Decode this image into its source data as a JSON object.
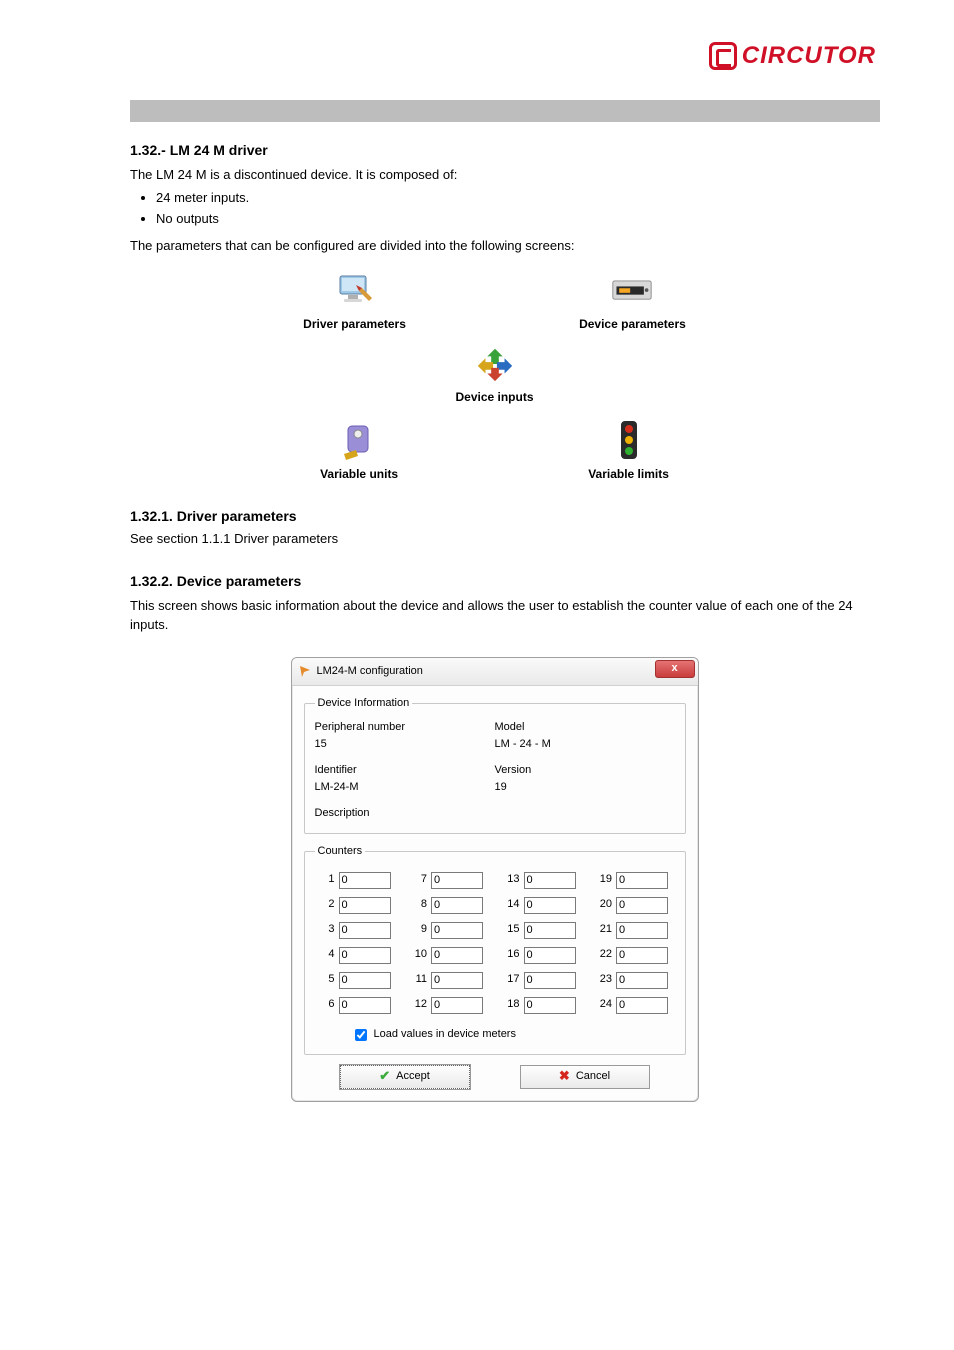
{
  "brand": "CIRCUTOR",
  "section": {
    "number_title": "1.32.- LM 24 M driver",
    "intro": "The LM 24 M is a discontinued device. It is composed of:",
    "bullets": [
      "24 meter inputs.",
      "No outputs"
    ],
    "config_line": "The parameters that can be configured are divided into the following screens:"
  },
  "nav": {
    "driver_parameters": "Driver parameters",
    "device_parameters": "Device parameters",
    "device_inputs": "Device inputs",
    "variable_units": "Variable units",
    "variable_limits": "Variable limits"
  },
  "subsections": {
    "driver_head": "1.32.1.  Driver parameters",
    "driver_text": "See section 1.1.1  Driver parameters",
    "device_head": "1.32.2.  Device parameters",
    "device_text": "This screen shows basic information about the device and allows the user to establish the counter value of each one of the 24 inputs."
  },
  "dialog": {
    "title": "LM24-M configuration",
    "close_glyph": "x",
    "device_info_legend": "Device Information",
    "peripheral_label": "Peripheral number",
    "peripheral_value": "15",
    "model_label": "Model",
    "model_value": "LM - 24 - M",
    "identifier_label": "Identifier",
    "identifier_value": "LM-24-M",
    "version_label": "Version",
    "version_value": "19",
    "description_label": "Description",
    "description_value": "",
    "counters_legend": "Counters",
    "counters": [
      {
        "n": "1",
        "v": "0"
      },
      {
        "n": "2",
        "v": "0"
      },
      {
        "n": "3",
        "v": "0"
      },
      {
        "n": "4",
        "v": "0"
      },
      {
        "n": "5",
        "v": "0"
      },
      {
        "n": "6",
        "v": "0"
      },
      {
        "n": "7",
        "v": "0"
      },
      {
        "n": "8",
        "v": "0"
      },
      {
        "n": "9",
        "v": "0"
      },
      {
        "n": "10",
        "v": "0"
      },
      {
        "n": "11",
        "v": "0"
      },
      {
        "n": "12",
        "v": "0"
      },
      {
        "n": "13",
        "v": "0"
      },
      {
        "n": "14",
        "v": "0"
      },
      {
        "n": "15",
        "v": "0"
      },
      {
        "n": "16",
        "v": "0"
      },
      {
        "n": "17",
        "v": "0"
      },
      {
        "n": "18",
        "v": "0"
      },
      {
        "n": "19",
        "v": "0"
      },
      {
        "n": "20",
        "v": "0"
      },
      {
        "n": "21",
        "v": "0"
      },
      {
        "n": "22",
        "v": "0"
      },
      {
        "n": "23",
        "v": "0"
      },
      {
        "n": "24",
        "v": "0"
      }
    ],
    "load_label": "Load values in device meters",
    "load_checked": true,
    "accept_label": "Accept",
    "cancel_label": "Cancel"
  }
}
